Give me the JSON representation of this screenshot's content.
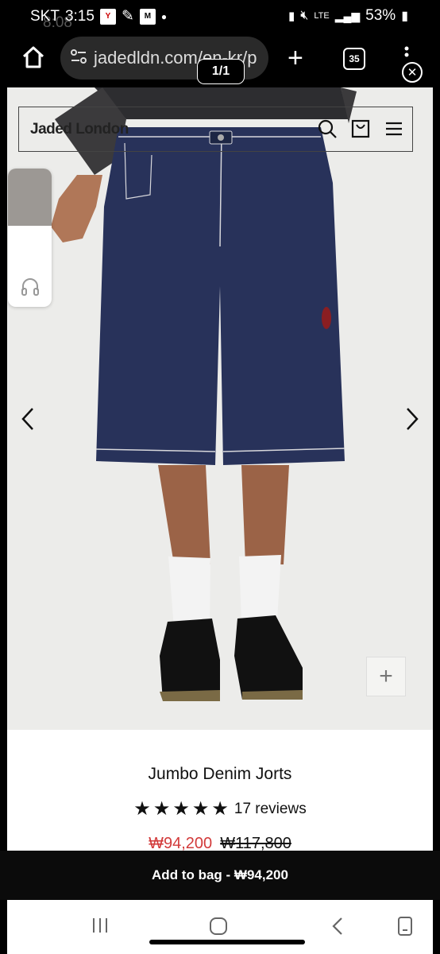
{
  "status_bar": {
    "carrier": "SKT",
    "time": "3:15",
    "ghost_time": "8:08",
    "network": "LTE",
    "battery": "53%"
  },
  "browser": {
    "url": "jadedldn.com/en-kr/p",
    "tab_count": "35",
    "page_counter": "1/1"
  },
  "site": {
    "logo": "Jaded London"
  },
  "product": {
    "title": "Jumbo Denim Jorts",
    "rating": 5,
    "reviews": "17 reviews",
    "sale_price": "₩94,200",
    "original_price": "₩117,800"
  },
  "cta": {
    "label": "Add to bag - ₩94,200"
  },
  "colors": {
    "sale": "#d23a3a",
    "denim": "#28325a",
    "button_bg": "#0b0b0b"
  }
}
